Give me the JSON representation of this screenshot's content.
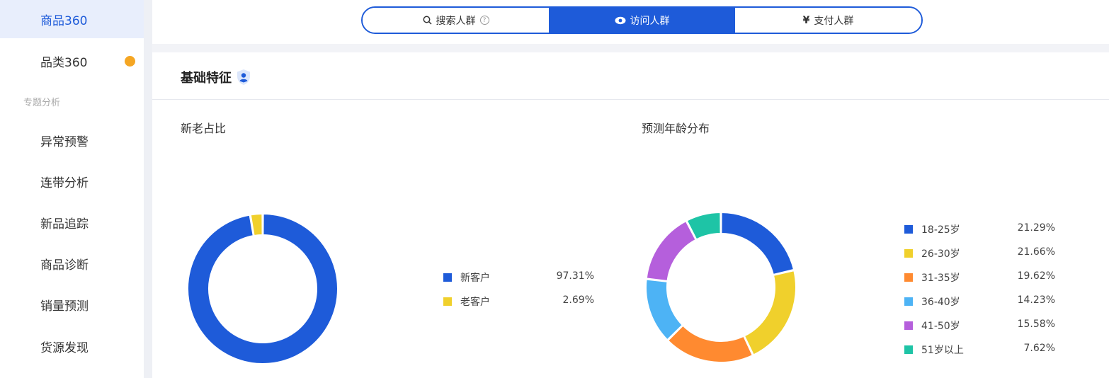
{
  "sidebar": {
    "items": [
      {
        "label": "商品360",
        "active": true
      },
      {
        "label": "品类360",
        "active": false,
        "has_dot": true
      }
    ],
    "group_label": "专题分析",
    "group_items": [
      {
        "label": "异常预警"
      },
      {
        "label": "连带分析"
      },
      {
        "label": "新品追踪"
      },
      {
        "label": "商品诊断"
      },
      {
        "label": "销量预测"
      },
      {
        "label": "货源发现"
      }
    ]
  },
  "topbar": {
    "tabs": [
      {
        "label": "搜索人群",
        "icon": "search-icon",
        "active": false,
        "has_help": true
      },
      {
        "label": "访问人群",
        "icon": "eye-icon",
        "active": true
      },
      {
        "label": "支付人群",
        "icon": "yen-icon",
        "active": false
      }
    ],
    "help_glyph": "?"
  },
  "panel": {
    "title": "基础特征"
  },
  "colors": {
    "accent": "#1e5bd9"
  },
  "chart_data": [
    {
      "type": "pie",
      "title": "新老占比",
      "series": [
        {
          "name": "新客户",
          "value": 97.31,
          "label": "97.31%",
          "color": "#1e5bd9"
        },
        {
          "name": "老客户",
          "value": 2.69,
          "label": "2.69%",
          "color": "#f0d02c"
        }
      ]
    },
    {
      "type": "pie",
      "title": "预测年龄分布",
      "series": [
        {
          "name": "18-25岁",
          "value": 21.29,
          "label": "21.29%",
          "color": "#1e5bd9"
        },
        {
          "name": "26-30岁",
          "value": 21.66,
          "label": "21.66%",
          "color": "#f0d02c"
        },
        {
          "name": "31-35岁",
          "value": 19.62,
          "label": "19.62%",
          "color": "#ff8a30"
        },
        {
          "name": "36-40岁",
          "value": 14.23,
          "label": "14.23%",
          "color": "#4db3f5"
        },
        {
          "name": "41-50岁",
          "value": 15.58,
          "label": "15.58%",
          "color": "#b55fdc"
        },
        {
          "name": "51岁以上",
          "value": 7.62,
          "label": "7.62%",
          "color": "#1ec4a6"
        }
      ]
    }
  ]
}
